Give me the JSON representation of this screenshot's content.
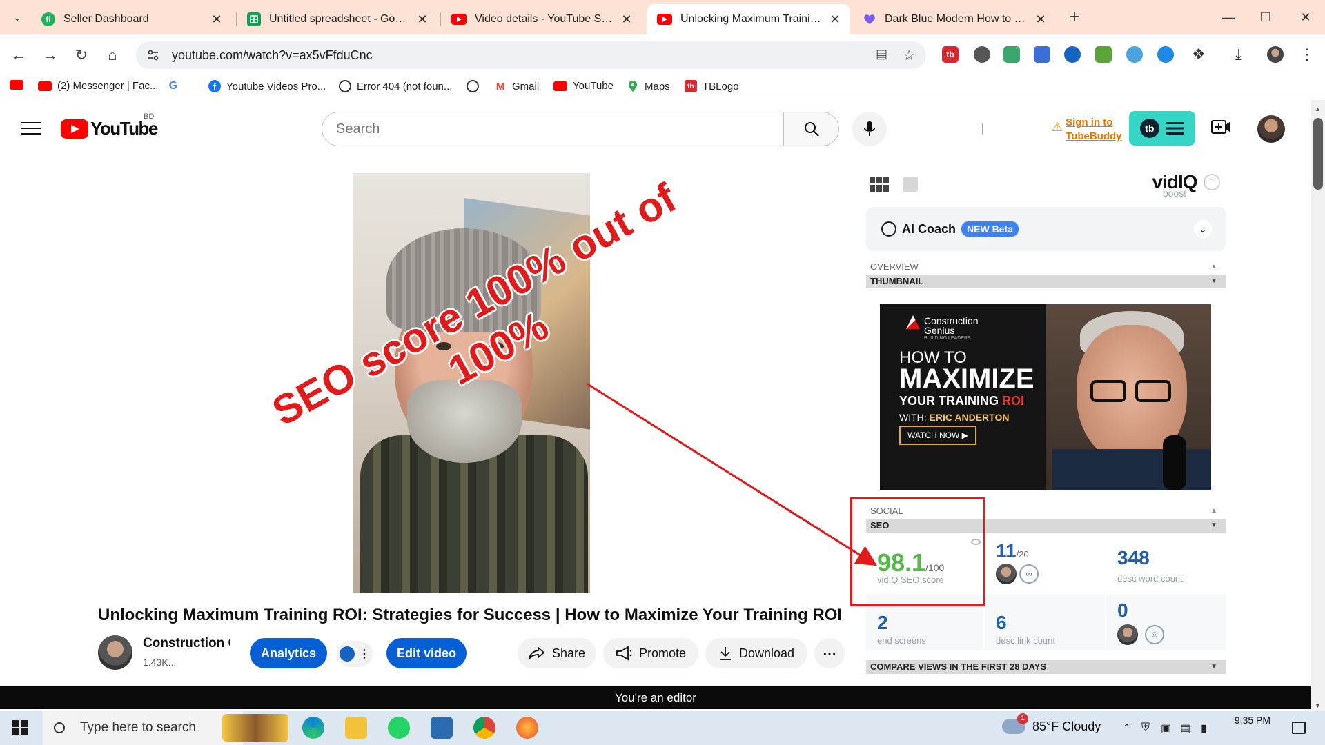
{
  "browser": {
    "tabs": [
      {
        "title": "Seller Dashboard",
        "active": false
      },
      {
        "title": "Untitled spreadsheet - Google Sheets",
        "active": false
      },
      {
        "title": "Video details - YouTube Studio",
        "active": false
      },
      {
        "title": "Unlocking Maximum Training ROI",
        "active": true
      },
      {
        "title": "Dark Blue Modern How to Become",
        "active": false
      }
    ],
    "url": "youtube.com/watch?v=ax5vFfduCnc",
    "bookmarks": [
      {
        "label": ""
      },
      {
        "label": "(2) Messenger | Fac..."
      },
      {
        "label": ""
      },
      {
        "label": "Youtube Videos Pro..."
      },
      {
        "label": "Error 404 (not foun..."
      },
      {
        "label": ""
      },
      {
        "label": "Gmail"
      },
      {
        "label": "YouTube"
      },
      {
        "label": "Maps"
      },
      {
        "label": "TBLogo"
      }
    ]
  },
  "youtube": {
    "logo_text": "YouTube",
    "country": "BD",
    "search_placeholder": "Search",
    "tubebuddy_sign_in": [
      "Sign in to",
      "TubeBuddy"
    ],
    "tubebuddy_badge": "tb"
  },
  "overlay": {
    "line1": "SEO score 100% out of",
    "line2": "100%"
  },
  "video": {
    "title": "Unlocking Maximum Training ROI: Strategies for Success | How to Maximize Your Training ROI",
    "channel": "Construction Genius",
    "subscribers": "1.43K...",
    "actions": {
      "analytics": "Analytics",
      "edit": "Edit video",
      "share": "Share",
      "promote": "Promote",
      "download": "Download"
    }
  },
  "vidiq": {
    "logo": "vidIQ",
    "logo_sub": "boost",
    "ai_coach": "AI Coach",
    "ai_badge": "NEW Beta",
    "sections": {
      "overview": "OVERVIEW",
      "thumbnail": "THUMBNAIL",
      "social": "SOCIAL",
      "seo": "SEO",
      "compare": "COMPARE VIEWS IN THE FIRST 28 DAYS"
    },
    "thumbnail": {
      "brand": "Construction",
      "brand2": "Genius",
      "brand_tag": "BUILDING LEADERS",
      "line1": "HOW TO",
      "line2": "MAXIMIZE",
      "line3a": "YOUR TRAINING ",
      "line3b": "ROI",
      "line4a": "WITH: ",
      "line4b": "ERIC ANDERTON",
      "cta": "WATCH NOW"
    },
    "seo_metrics": {
      "score": "98.1",
      "score_max": "/100",
      "score_label": "vidIQ SEO score",
      "tags_count": "11",
      "tags_max": "/20",
      "desc_words": "348",
      "desc_words_label": "desc word count",
      "end_screens": "2",
      "end_screens_label": "end screens",
      "desc_links": "6",
      "desc_links_label": "desc link count",
      "cards": "0"
    },
    "colors": {
      "score": "#56b847",
      "metric": "#1f5fa8"
    }
  },
  "banner": "You're an editor",
  "taskbar": {
    "search_placeholder": "Type here to search",
    "weather": "85°F  Cloudy",
    "time": "9:35 PM",
    "notif_count": "1"
  }
}
